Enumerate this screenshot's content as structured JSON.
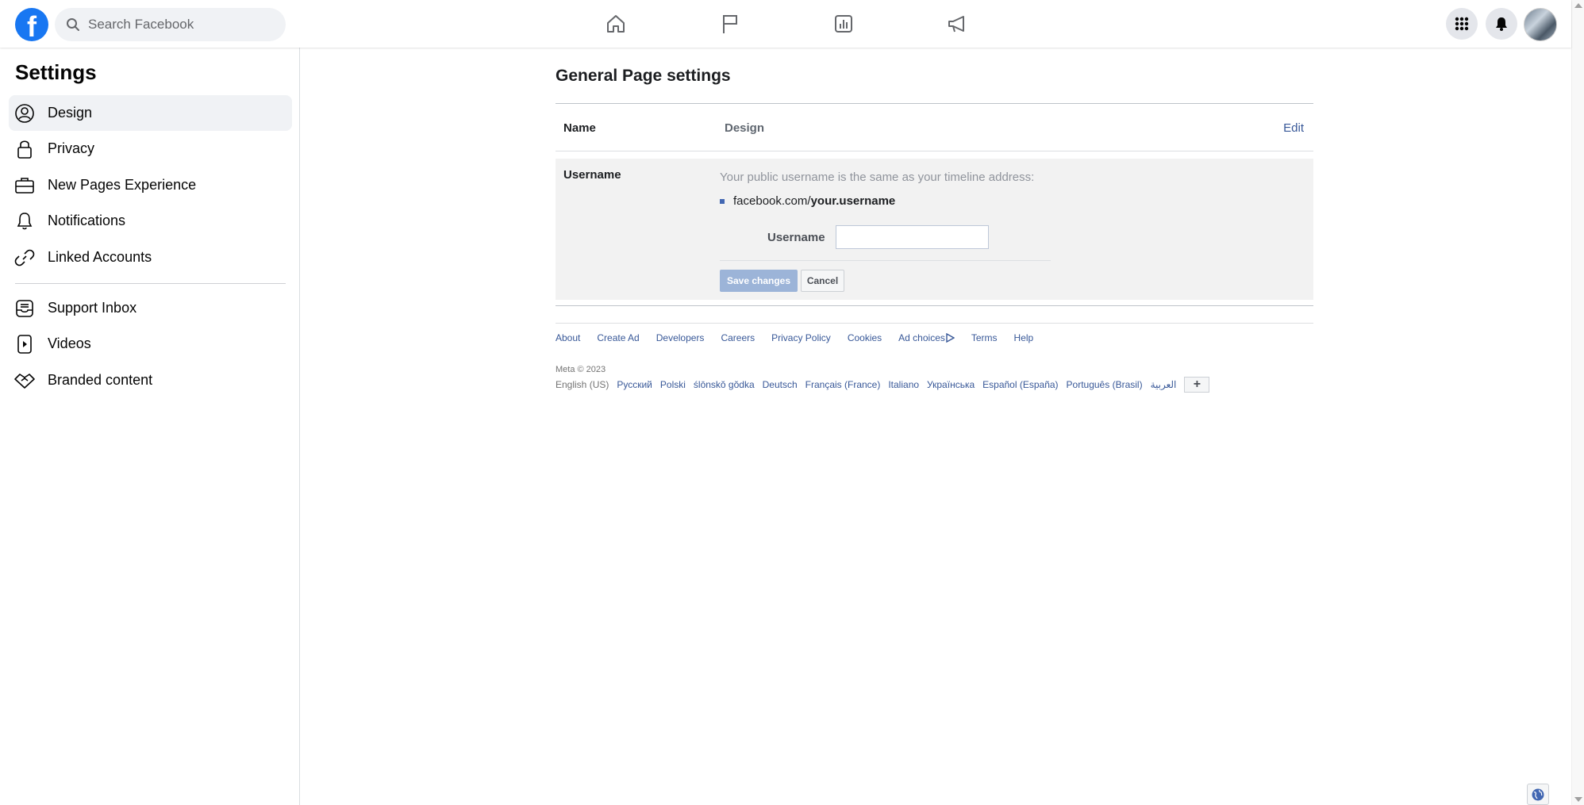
{
  "header": {
    "logo": "f",
    "search_placeholder": "Search Facebook",
    "nav_icons": [
      "home-icon",
      "flag-icon",
      "chart-icon",
      "megaphone-icon"
    ],
    "right_icons": [
      "menu-grid-icon",
      "bell-icon",
      "avatar"
    ]
  },
  "sidebar": {
    "title": "Settings",
    "items": [
      {
        "label": "Design",
        "icon": "user-circle-icon",
        "active": true
      },
      {
        "label": "Privacy",
        "icon": "lock-icon"
      },
      {
        "label": "New Pages Experience",
        "icon": "briefcase-icon"
      },
      {
        "label": "Notifications",
        "icon": "bell-icon"
      },
      {
        "label": "Linked Accounts",
        "icon": "link-icon"
      },
      {
        "label": "Support Inbox",
        "icon": "inbox-icon"
      },
      {
        "label": "Videos",
        "icon": "video-icon"
      },
      {
        "label": "Branded content",
        "icon": "handshake-icon"
      }
    ]
  },
  "main": {
    "title": "General Page settings",
    "name_row": {
      "label": "Name",
      "value": "Design",
      "edit": "Edit"
    },
    "username": {
      "label": "Username",
      "description": "Your public username is the same as your timeline address:",
      "url_prefix": "facebook.com/",
      "url_suffix": "your.username",
      "field_label": "Username",
      "field_value": "",
      "save": "Save changes",
      "cancel": "Cancel"
    }
  },
  "footer": {
    "links": [
      "About",
      "Create Ad",
      "Developers",
      "Careers",
      "Privacy Policy",
      "Cookies",
      "Ad choices",
      "Terms",
      "Help"
    ],
    "copyright": "Meta © 2023",
    "languages": [
      "English (US)",
      "Русский",
      "Polski",
      "ślōnskŏ gŏdka",
      "Deutsch",
      "Français (France)",
      "Italiano",
      "Українська",
      "Español (España)",
      "Português (Brasil)",
      "العربية"
    ],
    "more": "+"
  },
  "colors": {
    "brand": "#1877f2",
    "link": "#385898",
    "save_disabled": "#9cb4d8"
  }
}
